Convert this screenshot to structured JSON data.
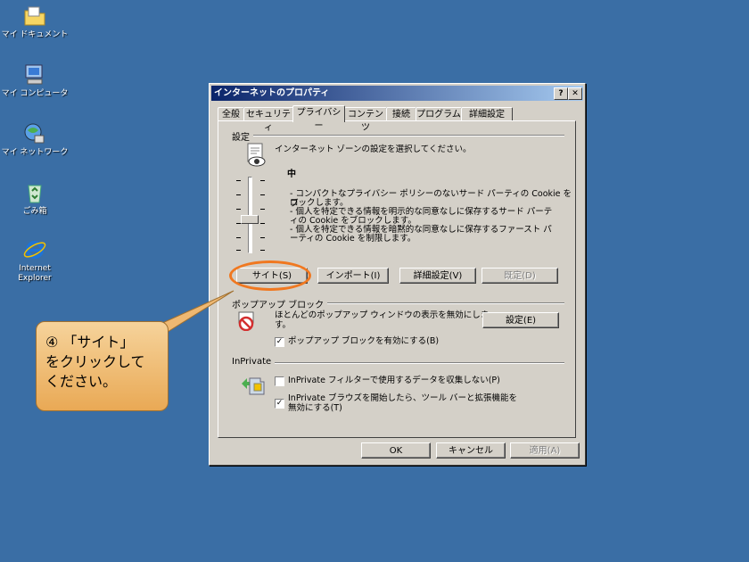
{
  "desktop": {
    "icons": [
      {
        "label": "マイ ドキュメント",
        "icon": "folder-icon"
      },
      {
        "label": "マイ コンピュータ",
        "icon": "computer-icon"
      },
      {
        "label": "マイ ネットワーク",
        "icon": "network-icon"
      },
      {
        "label": "ごみ箱",
        "icon": "recycle-bin-icon"
      },
      {
        "label": "Internet\nExplorer",
        "icon": "ie-icon"
      }
    ]
  },
  "dialog": {
    "title": "インターネットのプロパティ",
    "help_btn": "?",
    "close_btn": "✕",
    "tabs": [
      "全般",
      "セキュリティ",
      "プライバシー",
      "コンテンツ",
      "接続",
      "プログラム",
      "詳細設定"
    ],
    "active_tab": "プライバシー",
    "settings": {
      "group_title": "設定",
      "instruction": "インターネット ゾーンの設定を選択してください。",
      "level": "中",
      "description": [
        "- コンパクトなプライバシー ポリシーのないサード パーティの Cookie をブ",
        "  ロックします。",
        "- 個人を特定できる情報を明示的な同意なしに保存するサード パーテ",
        "  ィの Cookie をブロックします。",
        "- 個人を特定できる情報を暗黙的な同意なしに保存するファースト パ",
        "  ーティの Cookie を制限します。"
      ],
      "buttons": {
        "sites": "サイト(S)",
        "import": "インポート(I)",
        "advanced": "詳細設定(V)",
        "default": "既定(D)"
      }
    },
    "popup": {
      "group_title": "ポップアップ ブロック",
      "description": "ほとんどのポップアップ ウィンドウの表示を無効にしま\nす。",
      "settings_btn": "設定(E)",
      "checkbox_label": "ポップアップ ブロックを有効にする(B)",
      "checkbox_checked": "✓"
    },
    "inprivate": {
      "group_title": "InPrivate",
      "check1_label": "InPrivate フィルターで使用するデータを収集しない(P)",
      "check2_label": "InPrivate ブラウズを開始したら、ツール バーと拡張機能を\n無効にする(T)",
      "check2_checked": "✓"
    },
    "footer": {
      "ok": "OK",
      "cancel": "キャンセル",
      "apply": "適用(A)"
    }
  },
  "callout": {
    "text": "④ 「サイト」\nをクリックして\nください。",
    "fill": "#f0be78",
    "border": "#f07820"
  }
}
